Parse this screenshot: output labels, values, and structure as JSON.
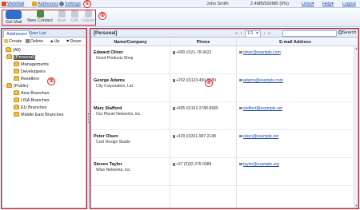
{
  "topbar": {
    "webmail": "WebMail",
    "addresses": "Addresses",
    "settings": "Settings",
    "user": "John Smith",
    "quota": "2.4MB/500MB (0%)",
    "links": "Links▾",
    "help": "Help▾",
    "logout": "Logout"
  },
  "callouts": [
    "①",
    "②",
    "③",
    "④"
  ],
  "toolbar": {
    "get_mail": "Get Mail",
    "new_contact": "New Contact",
    "new_group": "New",
    "edit": "Edit",
    "delete": "Delete"
  },
  "left_panel": {
    "tabs": [
      "Addresses",
      "User List"
    ],
    "tools": {
      "create": "Create",
      "delete": "Delete",
      "up": "Up",
      "down": "Down"
    },
    "tree": [
      {
        "label": "(All)",
        "level": 0
      },
      {
        "label": "(Personal)",
        "level": 0,
        "selected": true
      },
      {
        "label": "Managements",
        "level": 1
      },
      {
        "label": "Developpers",
        "level": 1
      },
      {
        "label": "Resellers",
        "level": 1
      },
      {
        "label": "(Public)",
        "level": 0
      },
      {
        "label": "Asia Branches",
        "level": 1
      },
      {
        "label": "USA Branches",
        "level": 1
      },
      {
        "label": "EU Branches",
        "level": 1
      },
      {
        "label": "Middle East Branches",
        "level": 1
      }
    ]
  },
  "right_panel": {
    "title": "[Personal]",
    "pager": {
      "first": "«",
      "prev": "‹",
      "page": "1/1",
      "next": "›",
      "last": "»"
    },
    "search_button": "Search",
    "columns": [
      "Name/Company",
      "Phone",
      "E-mail Address"
    ],
    "contacts": [
      {
        "name": "Edward Oliver",
        "company": "Good Products Shop",
        "phone": "+990 (0)21-78-9622",
        "email": "oliver@example.com"
      },
      {
        "name": "George Adams",
        "company": "City Corporation, Ltd.",
        "phone": "+292 (0)123-450-6789",
        "email": "adams@example.com"
      },
      {
        "name": "Mary Stafford",
        "company": "Our Planet Networks, inc.",
        "phone": "+895 (0)162-2788-8585",
        "email": "stafford@example.net"
      },
      {
        "name": "Peter Olsen",
        "company": "Cool Design Studio",
        "phone": "+429 (0)331-987-2148",
        "email": "olsen@example.net"
      },
      {
        "name": "Steven Taylor",
        "company": "Wise Networks, inc.",
        "phone": "+37 (0)92-276-0988",
        "email": "taylor@example.org"
      }
    ]
  },
  "colors": {
    "accent_blue": "#1f4ea8",
    "callout_red": "#d42020",
    "folder_yellow": "#f1c24a",
    "panel_border": "#9db3d6"
  }
}
